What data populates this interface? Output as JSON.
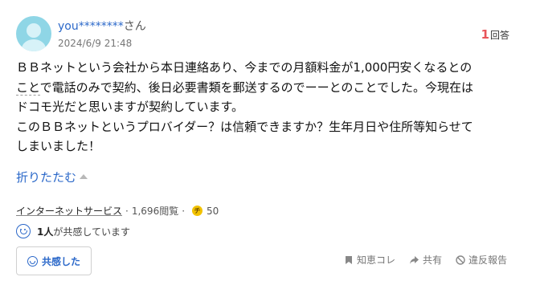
{
  "user": {
    "name": "you********",
    "suffix": "さん",
    "date": "2024/6/9 21:48"
  },
  "answers": {
    "count": "1",
    "label": "回答"
  },
  "question": {
    "lines": [
      "ＢＢネットという会社から本日連絡あり、今までの月額料金が1,000円安くなるとの",
      "ことで電話のみで契約、後日必要書類を郵送するのでーーとのことでした。今現在は",
      "ドコモ光だと思いますが契約しています。",
      "このＢＢネットというプロバイダー？は信頼できますか？生年月日や住所等知らせて",
      "しまいました！"
    ]
  },
  "fold": {
    "label": "折りたたむ"
  },
  "meta": {
    "category": "インターネットサービス",
    "separator": "·",
    "views": "1,696閲覧",
    "coin_glyph": "チ",
    "coins": "50"
  },
  "empathy": {
    "count": "1人",
    "text": "が共感しています"
  },
  "empathize_button": {
    "label": "共感した"
  },
  "actions": {
    "knowledge": "知恵コレ",
    "share": "共有",
    "report": "違反報告"
  },
  "colors": {
    "link_blue": "#2b68c9",
    "answer_red": "#e8555a",
    "avatar_teal": "#8fd6e6",
    "coin_gold": "#f2c200"
  }
}
